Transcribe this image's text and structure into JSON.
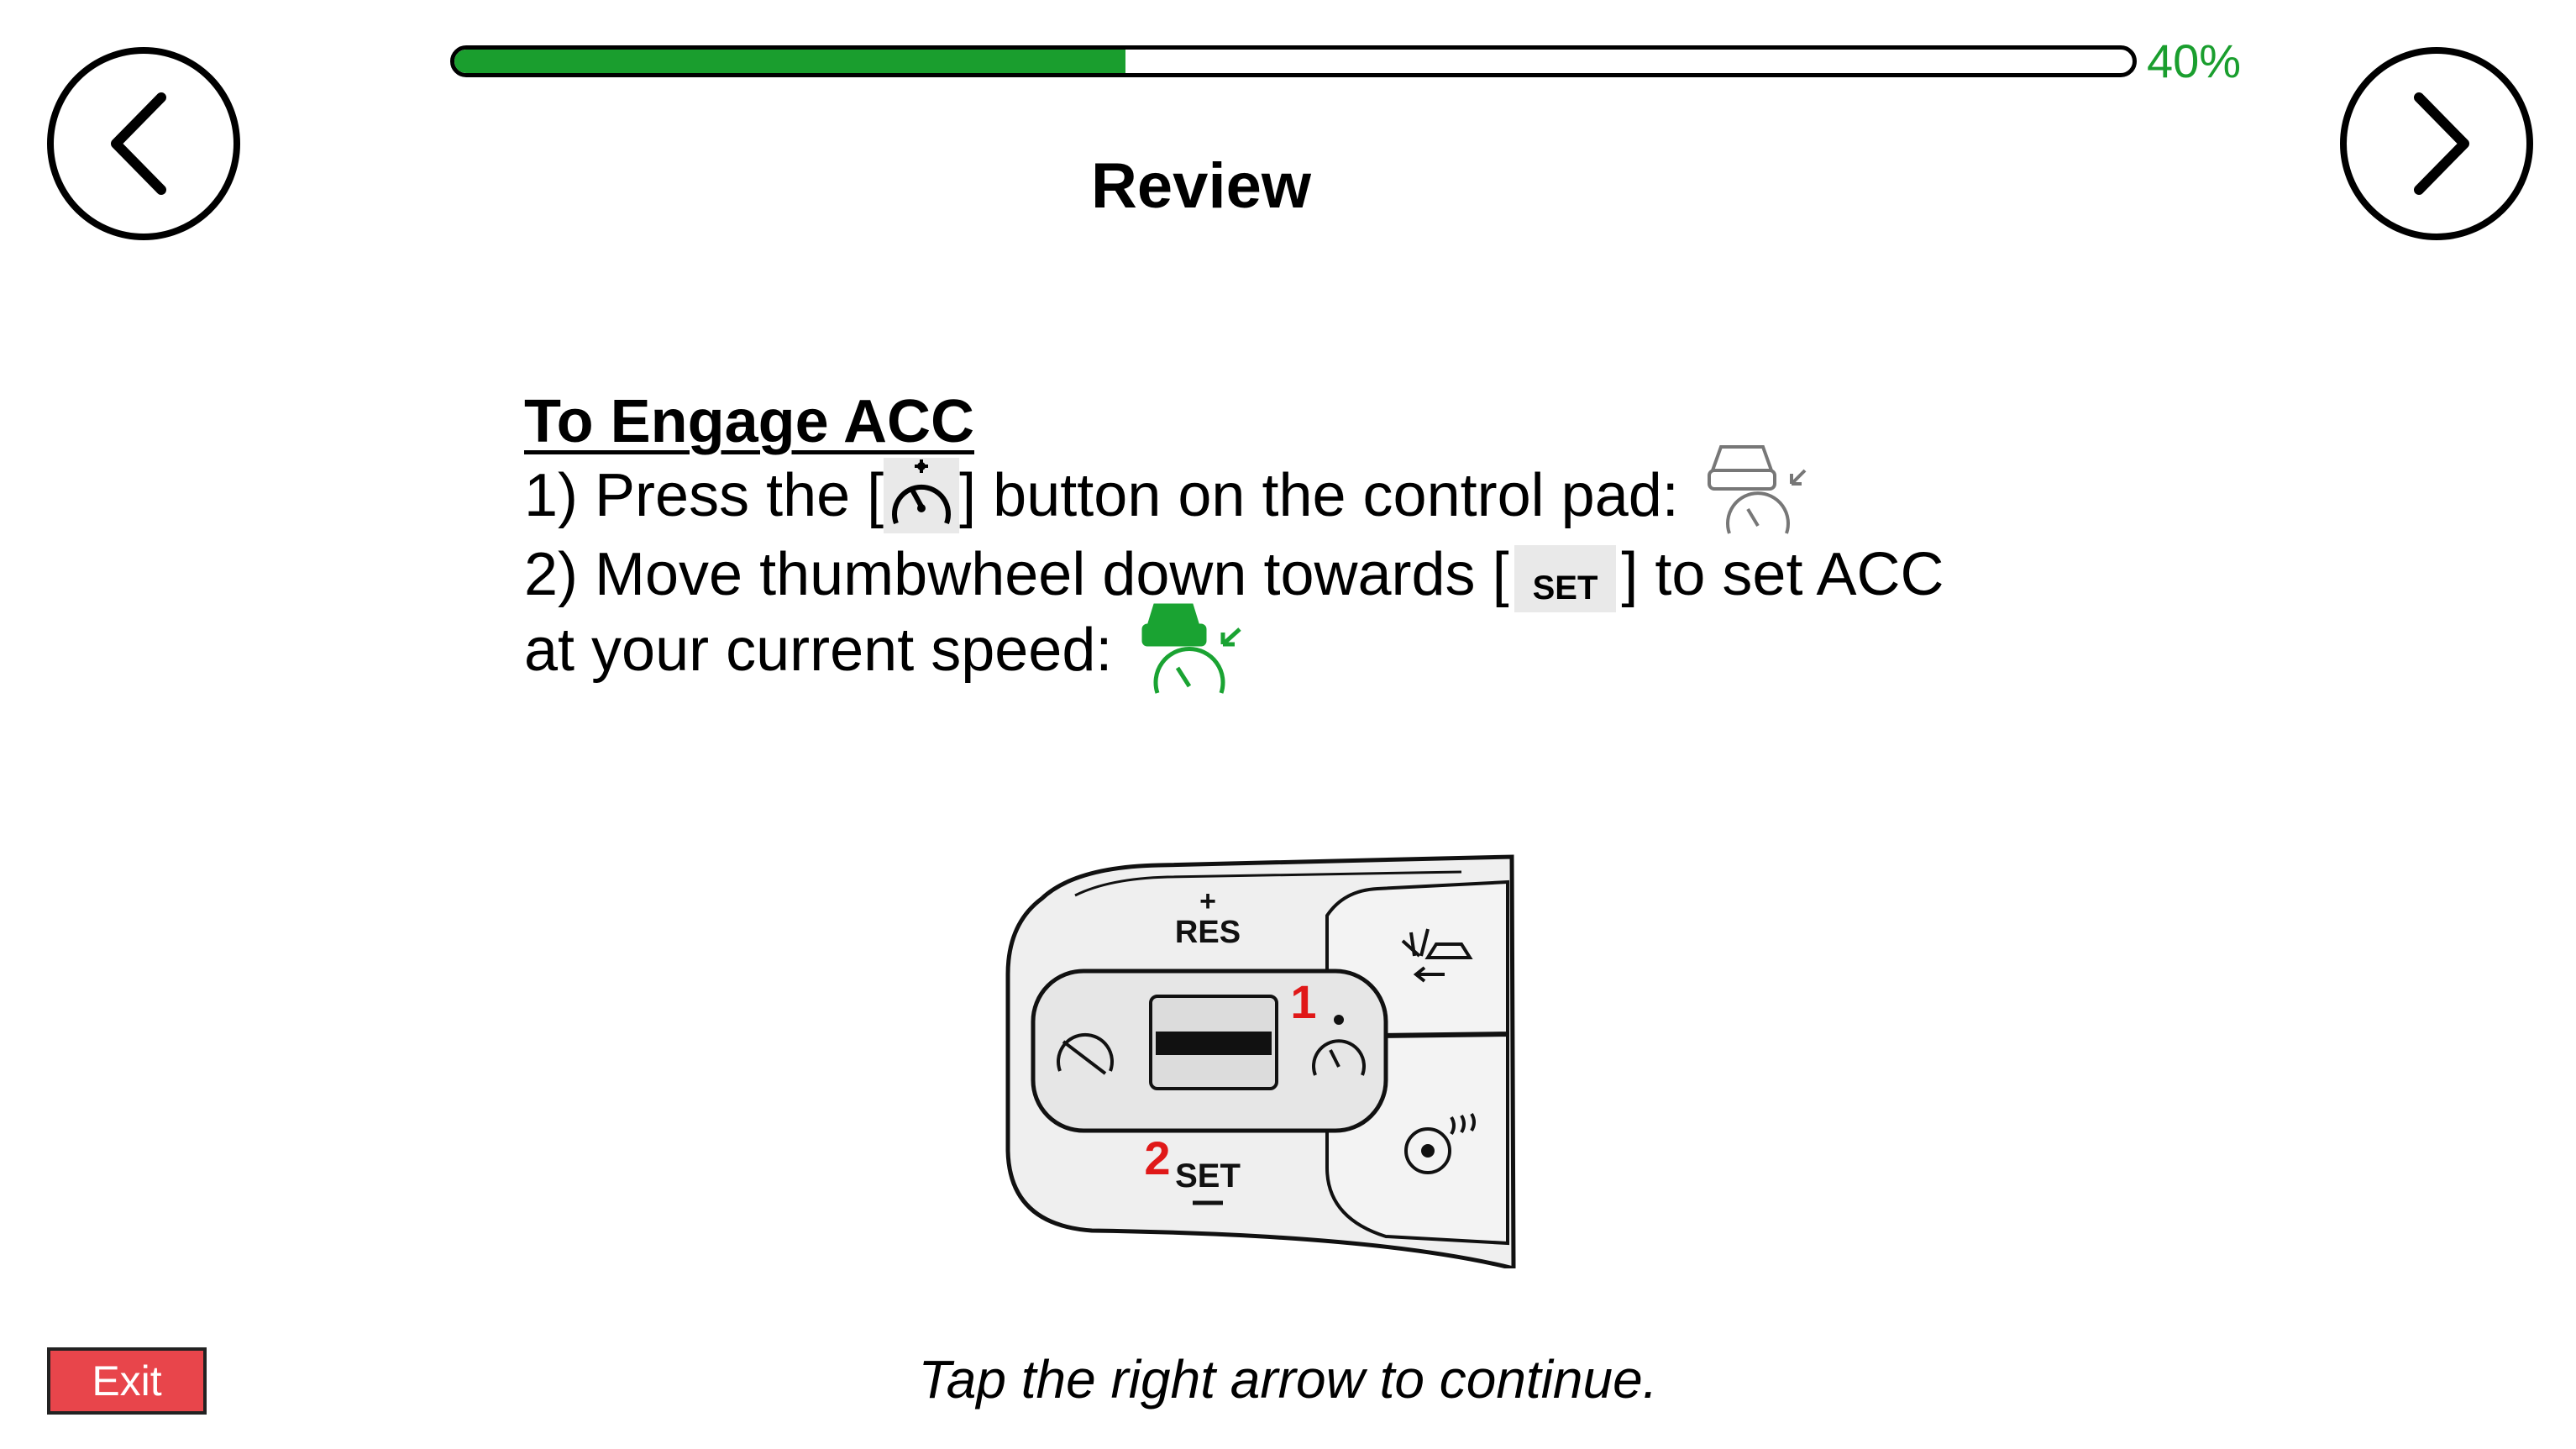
{
  "nav": {
    "back_icon": "chevron-left-icon",
    "next_icon": "chevron-right-icon"
  },
  "progress": {
    "value": 0.4,
    "label": "40%",
    "color": "#1a9e2e"
  },
  "screen": {
    "title": "Review"
  },
  "lesson": {
    "heading": "To Engage ACC",
    "step1_prefix": "1) Press the [",
    "step1_suffix": "] button on the control pad:",
    "step2_prefix": "2) Move thumbwheel down towards [",
    "step2_suffix": "] to set ACC",
    "step2_line2": "at your current speed:",
    "set_chip": "SET"
  },
  "control_pad": {
    "res_label": "RES",
    "res_plus": "+",
    "set_label": "SET",
    "callout_1": "1",
    "callout_2": "2",
    "callout_color": "#e01818"
  },
  "footer": {
    "instruction": "Tap the right arrow to continue.",
    "exit_label": "Exit",
    "exit_color": "#e8454b"
  }
}
